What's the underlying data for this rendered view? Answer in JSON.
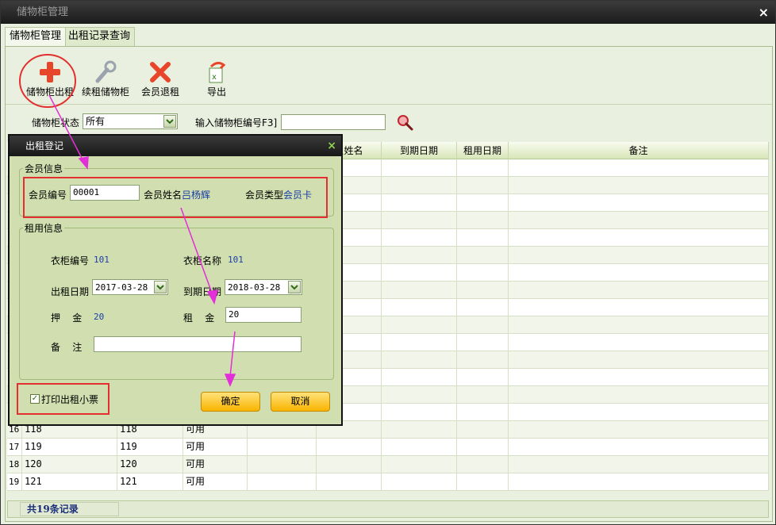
{
  "window": {
    "title": "储物柜管理",
    "close_label": "×"
  },
  "tabs": [
    {
      "label": "储物柜管理"
    },
    {
      "label": "出租记录查询"
    }
  ],
  "toolbar": {
    "rent_label": "储物柜出租",
    "renew_label": "续租储物柜",
    "return_label": "会员退租",
    "export_label": "导出"
  },
  "filter": {
    "status_label": "储物柜状态",
    "status_value": "所有",
    "code_label": "输入储物柜编号F3]",
    "code_value": ""
  },
  "grid": {
    "headers": [
      "员姓名",
      "到期日期",
      "租用日期",
      "备注"
    ],
    "rows": [
      {
        "idx": "16",
        "code": "118",
        "name": "118",
        "status": "可用"
      },
      {
        "idx": "17",
        "code": "119",
        "name": "119",
        "status": "可用"
      },
      {
        "idx": "18",
        "code": "120",
        "name": "120",
        "status": "可用"
      },
      {
        "idx": "19",
        "code": "121",
        "name": "121",
        "status": "可用"
      }
    ]
  },
  "status": {
    "record_count": "共19条记录"
  },
  "dialog": {
    "title": "出租登记",
    "close_label": "×",
    "member_group": "会员信息",
    "member_no_label": "会员编号",
    "member_no_value": "00001",
    "member_name_label": "会员姓名",
    "member_name_value": "吕杨辉",
    "member_type_label": "会员类型",
    "member_type_value": "会员卡",
    "rent_group": "租用信息",
    "locker_no_label": "衣柜编号",
    "locker_no_value": "101",
    "locker_name_label": "衣柜名称",
    "locker_name_value": "101",
    "rent_date_label": "出租日期",
    "rent_date_value": "2017-03-28",
    "expire_date_label": "到期日期",
    "expire_date_value": "2018-03-28",
    "deposit_label": "押    金",
    "deposit_value": "20",
    "rent_fee_label": "租    金",
    "rent_fee_value": "20",
    "remark_label": "备    注",
    "remark_value": "",
    "print_label": "打印出租小票",
    "print_checked": "✓",
    "ok_label": "确定",
    "cancel_label": "取消"
  },
  "colors": {
    "highlight": "#e32f2f",
    "arrow": "#e22fd8",
    "accent_button": "#f9b400"
  }
}
